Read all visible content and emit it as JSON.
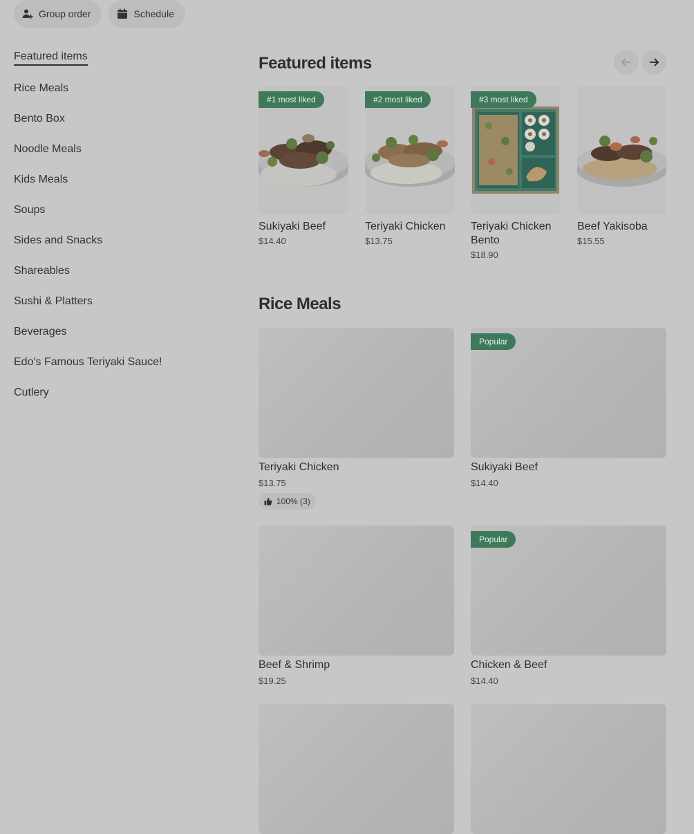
{
  "top_actions": [
    {
      "label": "Group order",
      "icon": "person-add-icon"
    },
    {
      "label": "Schedule",
      "icon": "calendar-icon"
    }
  ],
  "sidebar": {
    "items": [
      {
        "label": "Featured items",
        "active": true
      },
      {
        "label": "Rice Meals"
      },
      {
        "label": "Bento Box"
      },
      {
        "label": "Noodle Meals"
      },
      {
        "label": "Kids Meals"
      },
      {
        "label": "Soups"
      },
      {
        "label": "Sides and Snacks"
      },
      {
        "label": "Shareables"
      },
      {
        "label": "Sushi & Platters"
      },
      {
        "label": "Beverages"
      },
      {
        "label": "Edo's Famous Teriyaki Sauce!"
      },
      {
        "label": "Cutlery"
      }
    ]
  },
  "featured": {
    "title": "Featured items",
    "items": [
      {
        "badge": "#1 most liked",
        "name": "Sukiyaki Beef",
        "price": "$14.40",
        "image": "sukiyaki-beef-bowl"
      },
      {
        "badge": "#2 most liked",
        "name": "Teriyaki Chicken",
        "price": "$13.75",
        "image": "teriyaki-chicken-bowl"
      },
      {
        "badge": "#3 most liked",
        "name": "Teriyaki Chicken Bento",
        "price": "$18.90",
        "image": "teriyaki-chicken-bento-box"
      },
      {
        "badge": "",
        "name": "Beef Yakisoba",
        "price": "$15.55",
        "image": "beef-yakisoba-bowl"
      }
    ]
  },
  "rice_meals": {
    "title": "Rice Meals",
    "items": [
      {
        "name": "Teriyaki Chicken",
        "price": "$13.75",
        "badge": "",
        "rating": "100% (3)"
      },
      {
        "name": "Sukiyaki Beef",
        "price": "$14.40",
        "badge": "Popular",
        "rating": ""
      },
      {
        "name": "Beef & Shrimp",
        "price": "$19.25",
        "badge": "",
        "rating": ""
      },
      {
        "name": "Chicken & Beef",
        "price": "$14.40",
        "badge": "Popular",
        "rating": ""
      }
    ]
  },
  "colors": {
    "badge_green": "#3d7a5a",
    "overlay_gray": "#c7c7c7"
  }
}
